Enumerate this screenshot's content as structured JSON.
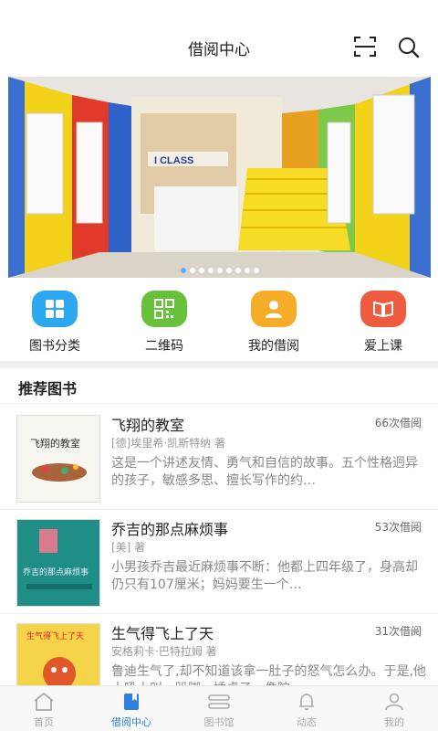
{
  "header": {
    "title": "借阅中心",
    "scan_icon": "scan-icon",
    "search_icon": "search-icon"
  },
  "banner": {
    "logo_text": "I CLASS",
    "dots": 9,
    "active_dot": 0
  },
  "quick_actions": [
    {
      "label": "图书分类",
      "icon": "grid-icon",
      "color": "#2ba8f0"
    },
    {
      "label": "二维码",
      "icon": "qrcode-icon",
      "color": "#68c13a"
    },
    {
      "label": "我的借阅",
      "icon": "user-icon",
      "color": "#f5ac26"
    },
    {
      "label": "爱上课",
      "icon": "book-open-icon",
      "color": "#ef5b3e"
    }
  ],
  "section": {
    "title": "推荐图书"
  },
  "books": [
    {
      "name": "飞翔的教室",
      "count": "66次借阅",
      "author": "[德]埃里希·凯斯特纳 著",
      "desc": "这是一个讲述友情、勇气和自信的故事。五个性格迥异的孩子，敏感多思、擅长写作的约…",
      "cover_text": "飞翔的教室"
    },
    {
      "name": "乔吉的那点麻烦事",
      "count": "53次借阅",
      "author": "[美] 著",
      "desc": "小男孩乔吉最近麻烦事不断：他都上四年级了，身高却仍只有107厘米；妈妈要生一个…",
      "cover_text": "乔吉的那点麻烦事"
    },
    {
      "name": "生气得飞上了天",
      "count": "31次借阅",
      "author": "安格莉卡·巴特拉姆 著",
      "desc": "鲁迪生气了,却不知道该拿一肚子的怒气怎么办。于是,他大吼大叫、跺脚、捶桌子、像陀",
      "cover_text": "生气得飞上了天"
    }
  ],
  "tabbar": {
    "active": 1,
    "tabs": [
      {
        "label": "首页",
        "icon": "home-icon"
      },
      {
        "label": "借阅中心",
        "icon": "bookmark-icon"
      },
      {
        "label": "图书馆",
        "icon": "library-icon"
      },
      {
        "label": "动态",
        "icon": "bell-icon"
      },
      {
        "label": "我的",
        "icon": "profile-icon"
      }
    ]
  }
}
